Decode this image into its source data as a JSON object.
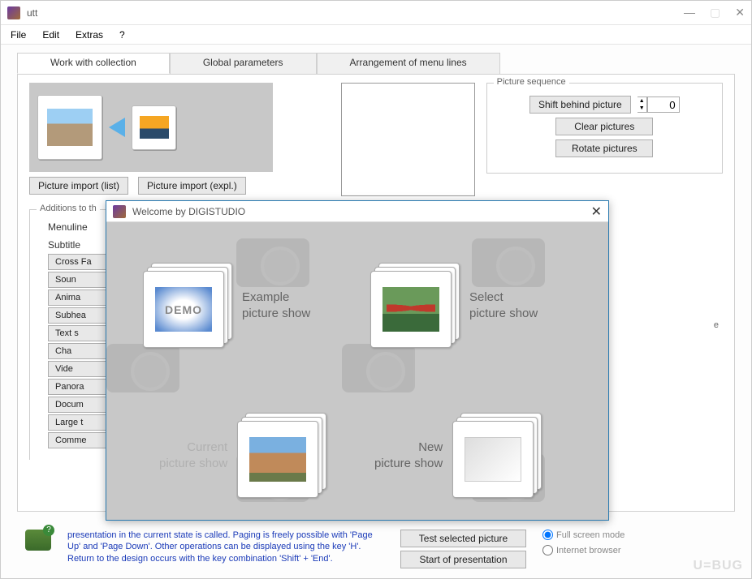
{
  "app": {
    "title": "utt"
  },
  "menu": {
    "file": "File",
    "edit": "Edit",
    "extras": "Extras",
    "help": "?"
  },
  "tabs": {
    "work": "Work with collection",
    "global": "Global parameters",
    "arrange": "Arrangement of menu lines"
  },
  "buttons": {
    "import_list": "Picture import (list)",
    "import_expl": "Picture import (expl.)",
    "shift_behind": "Shift behind picture",
    "clear": "Clear pictures",
    "rotate": "Rotate pictures",
    "test": "Test selected picture",
    "start": "Start of presentation"
  },
  "spinner_value": "0",
  "fieldsets": {
    "picseq": "Picture sequence",
    "additions": "Additions to th"
  },
  "additions": {
    "menuline": "Menuline",
    "subtitle": "Subtitle",
    "items": [
      "Cross Fa",
      "Soun",
      "Anima",
      "Subhea",
      "Text s",
      "Cha",
      "Vide",
      "Panora",
      "Docum",
      "Large t",
      "Comme"
    ]
  },
  "help_text": "presentation in the current state is called. Paging is freely possible with 'Page Up' and 'Page Down'. Other operations can be displayed using the key 'H'. Return to the design occurs with the key combination 'Shift' + 'End'.",
  "radios": {
    "fullscreen": "Full screen mode",
    "browser": "Internet browser",
    "extra": "e"
  },
  "dialog": {
    "title": "Welcome by DIGISTUDIO",
    "example": "Example\npicture show",
    "select": "Select\npicture show",
    "current": "Current\npicture show",
    "new": "New\npicture show",
    "demo_text": "DEMO"
  },
  "watermark": "U=BUG"
}
